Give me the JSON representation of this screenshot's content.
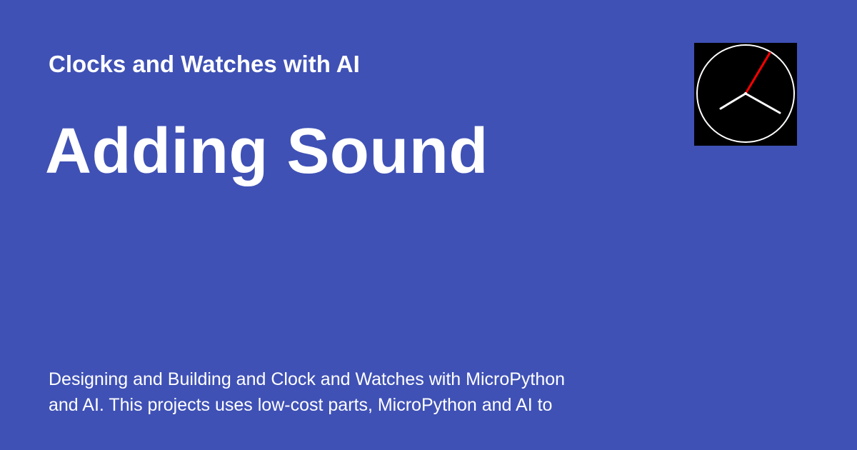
{
  "header": {
    "site_title": "Clocks and Watches with AI"
  },
  "main": {
    "page_title": "Adding Sound",
    "description": "Designing and Building and Clock and Watches with MicroPython\nand AI.  This projects uses low-cost parts, MicroPython and AI to"
  },
  "logo": {
    "icon": "clock-icon",
    "colors": {
      "face": "#000000",
      "ring": "#ffffff",
      "hands": "#ffffff",
      "second_hand": "#ff0000"
    }
  },
  "theme": {
    "background": "#3f51b5",
    "text": "#ffffff"
  }
}
